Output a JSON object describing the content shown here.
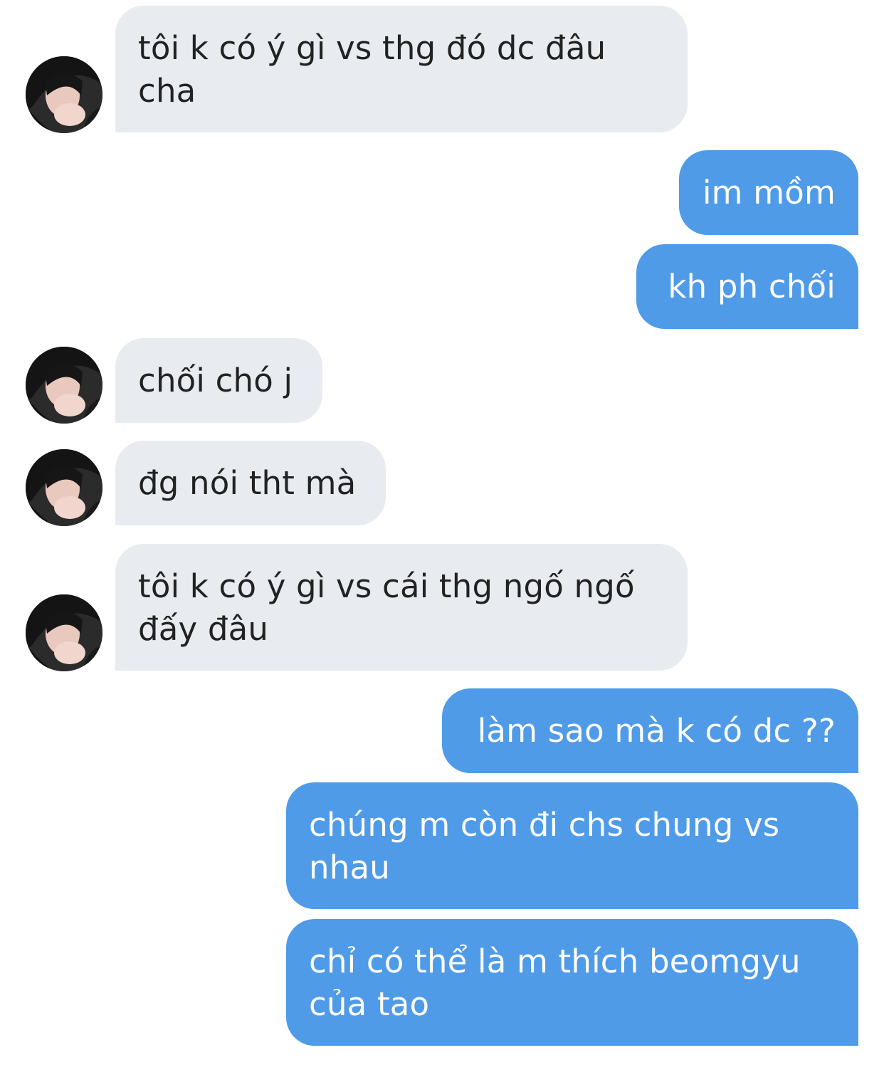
{
  "colors": {
    "incoming_bubble": "#e8ebef",
    "incoming_text": "#222222",
    "outgoing_bubble": "#4f9be8",
    "outgoing_text": "#ffffff"
  },
  "avatar_icon": "profile-photo-avatar-icon",
  "messages": [
    {
      "direction": "incoming",
      "lines": [
        "tôi k có ý gì vs thg đó dc đâu",
        "cha"
      ]
    },
    {
      "direction": "outgoing",
      "lines": [
        "im mồm"
      ]
    },
    {
      "direction": "outgoing",
      "lines": [
        "kh ph chối"
      ]
    },
    {
      "direction": "incoming",
      "lines": [
        "chối chó j"
      ]
    },
    {
      "direction": "incoming",
      "lines": [
        "đg nói tht mà"
      ]
    },
    {
      "direction": "incoming",
      "lines": [
        "tôi k có ý gì vs cái thg ngố ngố",
        "đấy đâu"
      ]
    },
    {
      "direction": "outgoing",
      "lines": [
        "làm sao mà k có dc ??"
      ]
    },
    {
      "direction": "outgoing",
      "lines": [
        "chúng m còn đi chs chung vs",
        "nhau"
      ]
    },
    {
      "direction": "outgoing",
      "lines": [
        "chỉ có thể là m thích beomgyu",
        "của tao"
      ]
    }
  ]
}
